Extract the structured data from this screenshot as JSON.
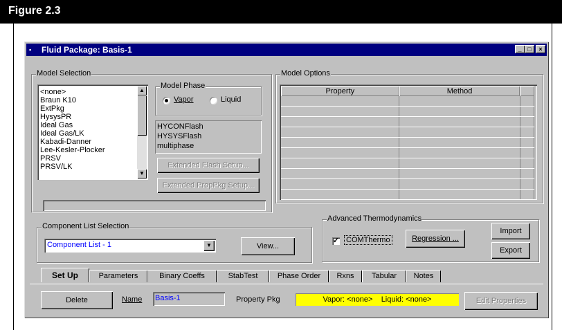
{
  "figure": {
    "title": "Figure 2.3"
  },
  "window": {
    "title": "Fluid Package: Basis-1",
    "controls": {
      "minimize": "_",
      "maximize": "□",
      "close": "×"
    }
  },
  "model_selection": {
    "label": "Model Selection",
    "items": [
      "<none>",
      "Braun K10",
      "ExtPkg",
      "HysysPR",
      "Ideal Gas",
      "Ideal Gas/LK",
      "Kabadi-Danner",
      "Lee-Kesler-Plocker",
      "PRSV",
      "PRSV/LK"
    ],
    "selected": "<none>"
  },
  "model_phase": {
    "label": "Model Phase",
    "vapor_label": "Vapor",
    "liquid_label": "Liquid",
    "selected": "Vapor"
  },
  "flash_options": [
    "HYCONFlash",
    "HYSYSFlash",
    "multiphase"
  ],
  "buttons": {
    "extended_flash_setup": "Extended Flash Setup...",
    "extended_proppkg_setup": "Extended PropPkg Setup...",
    "view": "View...",
    "regression": "Regression ...",
    "import": "Import",
    "export": "Export",
    "delete": "Delete",
    "edit_properties": "Edit Properties"
  },
  "model_options": {
    "label": "Model Options",
    "columns": [
      "Property",
      "Method"
    ]
  },
  "component_list": {
    "label": "Component List Selection",
    "value": "Component List - 1"
  },
  "advanced_thermo": {
    "label": "Advanced Thermodynamics",
    "comthermo_label": "COMThermo",
    "comthermo_checked": true
  },
  "tabs": [
    {
      "label": "Set Up",
      "active": true
    },
    {
      "label": "Parameters",
      "active": false
    },
    {
      "label": "Binary Coeffs",
      "active": false
    },
    {
      "label": "StabTest",
      "active": false
    },
    {
      "label": "Phase Order",
      "active": false
    },
    {
      "label": "Rxns",
      "active": false
    },
    {
      "label": "Tabular",
      "active": false
    },
    {
      "label": "Notes",
      "active": false
    }
  ],
  "footer": {
    "name_label": "Name",
    "name_value": "Basis-1",
    "property_pkg_label": "Property Pkg",
    "property_pkg_value": "Vapor: <none>    Liquid: <none>",
    "property_pkg_color": "#ffff00"
  },
  "colors": {
    "titlebar": "#000080",
    "window_face": "#c0c0c0",
    "link_blue": "#0000ff"
  }
}
